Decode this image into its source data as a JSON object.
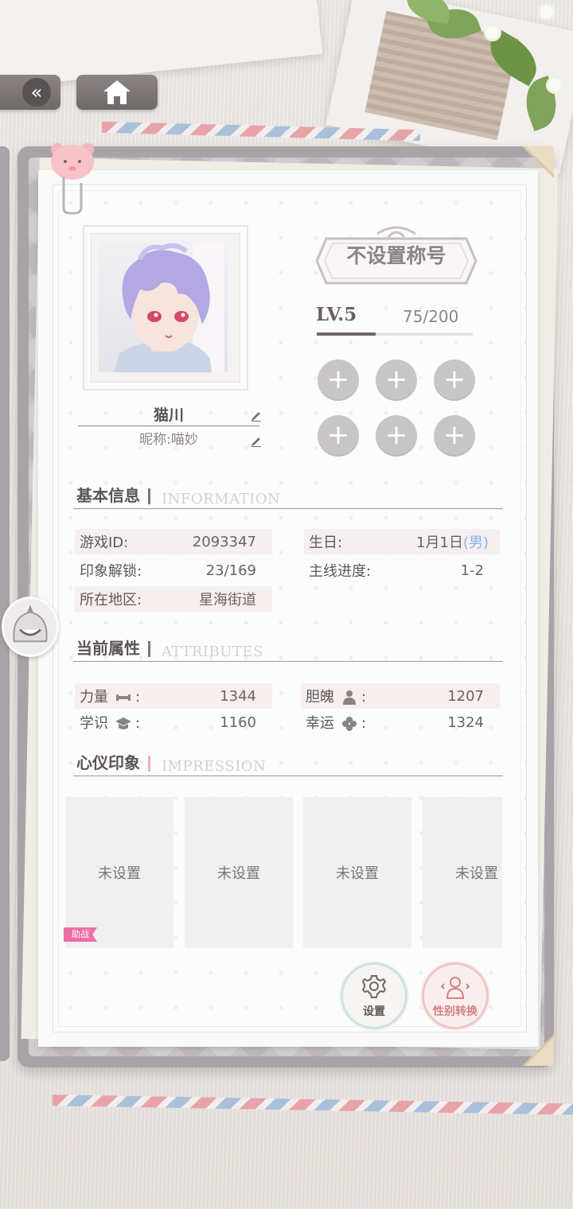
{
  "nav": {
    "back_icon": "double-chevron-left-icon",
    "home_icon": "home-icon"
  },
  "profile": {
    "name": "猫川",
    "nickname": "昵称:喵妙",
    "title": "不设置称号",
    "level": "LV.5",
    "exp": "75/200",
    "exp_progress": 0.375
  },
  "badges": [
    "+",
    "+",
    "+",
    "+",
    "+",
    "+"
  ],
  "sections": {
    "basic": {
      "cn": "基本信息",
      "en": "INFORMATION"
    },
    "attributes": {
      "cn": "当前属性",
      "en": "ATTRIBUTES"
    },
    "impression": {
      "cn": "心仪印象",
      "en": "IMPRESSION"
    }
  },
  "info": {
    "game_id_label": "游戏ID:",
    "game_id": "2093347",
    "birthday_label": "生日:",
    "birthday": "1月1日",
    "gender": "(男)",
    "unlock_label": "印象解锁:",
    "unlock": "23/169",
    "progress_label": "主线进度:",
    "progress": "1-2",
    "region_label": "所在地区:",
    "region": "星海街道"
  },
  "attributes": {
    "strength_label": "力量",
    "strength": "1344",
    "courage_label": "胆魄",
    "courage": "1207",
    "knowledge_label": "学识",
    "knowledge": "1160",
    "luck_label": "幸运",
    "luck": "1324",
    "colon": ":"
  },
  "impressions": [
    "未设置",
    "未设置",
    "未设置",
    "未设置"
  ],
  "assist_tag": "助战",
  "buttons": {
    "settings": "设置",
    "gender_switch": "性别转换"
  },
  "colors": {
    "accent_pink": "#ef6ea4",
    "male_blue": "#8cb2e6",
    "badge_gray": "#c8c5c6"
  }
}
